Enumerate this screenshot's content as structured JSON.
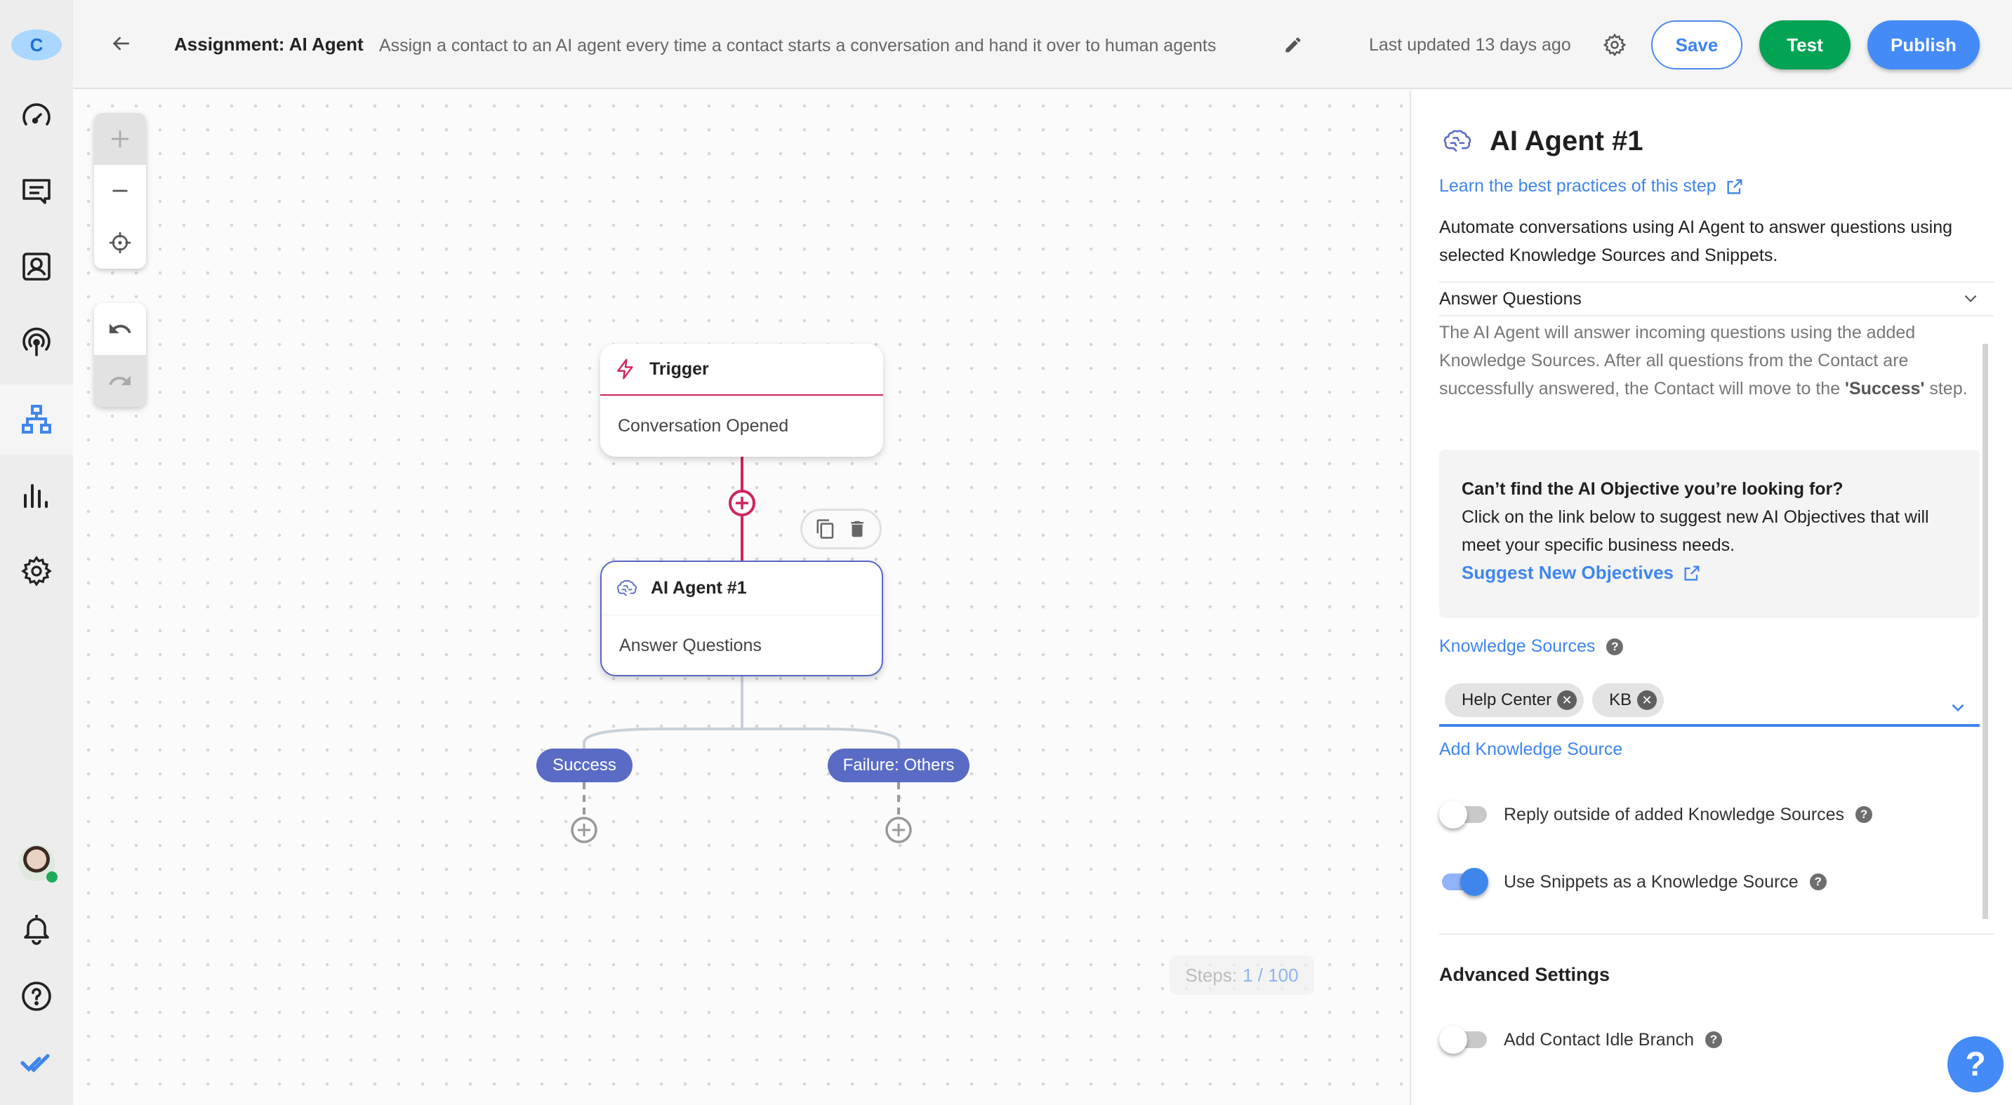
{
  "sidebar": {
    "org_initial": "C",
    "items": [
      {
        "name": "dashboard",
        "icon": "speedometer-icon"
      },
      {
        "name": "inbox",
        "icon": "message-icon"
      },
      {
        "name": "contacts",
        "icon": "contact-icon"
      },
      {
        "name": "broadcasts",
        "icon": "broadcast-icon"
      },
      {
        "name": "workflows",
        "icon": "workflow-icon",
        "active": true
      },
      {
        "name": "reports",
        "icon": "bar-chart-icon"
      },
      {
        "name": "settings",
        "icon": "gear-icon"
      }
    ],
    "bottom": [
      {
        "name": "user-avatar",
        "status": "online"
      },
      {
        "name": "notifications",
        "icon": "bell-icon"
      },
      {
        "name": "help",
        "icon": "help-circle-icon"
      },
      {
        "name": "brand",
        "icon": "double-check-icon"
      }
    ]
  },
  "header": {
    "title": "Assignment: AI Agent",
    "description": "Assign a contact to an AI agent every time a contact starts a conversation and hand it over to human agents",
    "last_updated": "Last updated 13 days ago",
    "save_label": "Save",
    "test_label": "Test",
    "publish_label": "Publish"
  },
  "canvas": {
    "controls": {
      "zoom_in": "plus-icon",
      "zoom_out": "minus-icon",
      "recenter": "crosshair-icon",
      "undo": "undo-icon",
      "redo": "redo-icon"
    },
    "nodes": {
      "trigger": {
        "title": "Trigger",
        "body": "Conversation Opened"
      },
      "agent": {
        "title": "AI Agent #1",
        "body": "Answer Questions"
      }
    },
    "branches": {
      "success": "Success",
      "failure": "Failure: Others"
    },
    "steps_label": "Steps:",
    "steps_value": "1 / 100"
  },
  "panel": {
    "title": "AI Agent #1",
    "learn_link": "Learn the best practices of this step",
    "description": "Automate conversations using AI Agent to answer questions using selected Knowledge Sources and Snippets.",
    "objective": "Answer Questions",
    "objective_desc_1": "The AI Agent will answer incoming questions using the added Knowledge Sources. After all questions from the Contact are successfully answered, the Contact will move to the ",
    "objective_desc_bold": "'Success'",
    "objective_desc_2": " step.",
    "suggest_title": "Can’t find the AI Objective you’re looking for?",
    "suggest_text": "Click on the link below to suggest new AI Objectives that will meet your specific business needs.",
    "suggest_link": "Suggest New Objectives",
    "knowledge_sources_label": "Knowledge Sources",
    "knowledge_sources": [
      "Help Center",
      "KB"
    ],
    "add_knowledge_source": "Add Knowledge Source",
    "toggles": {
      "reply_outside": {
        "label": "Reply outside of added Knowledge Sources",
        "on": false
      },
      "use_snippets": {
        "label": "Use Snippets as a Knowledge Source",
        "on": true
      },
      "idle_branch": {
        "label": "Add Contact Idle Branch",
        "on": false
      }
    },
    "advanced_title": "Advanced Settings",
    "help_fab": "?"
  },
  "colors": {
    "primary": "#448bf8",
    "test_green": "#03a354",
    "trigger_accent": "#d0245d",
    "agent_accent": "#5a6bc6"
  }
}
